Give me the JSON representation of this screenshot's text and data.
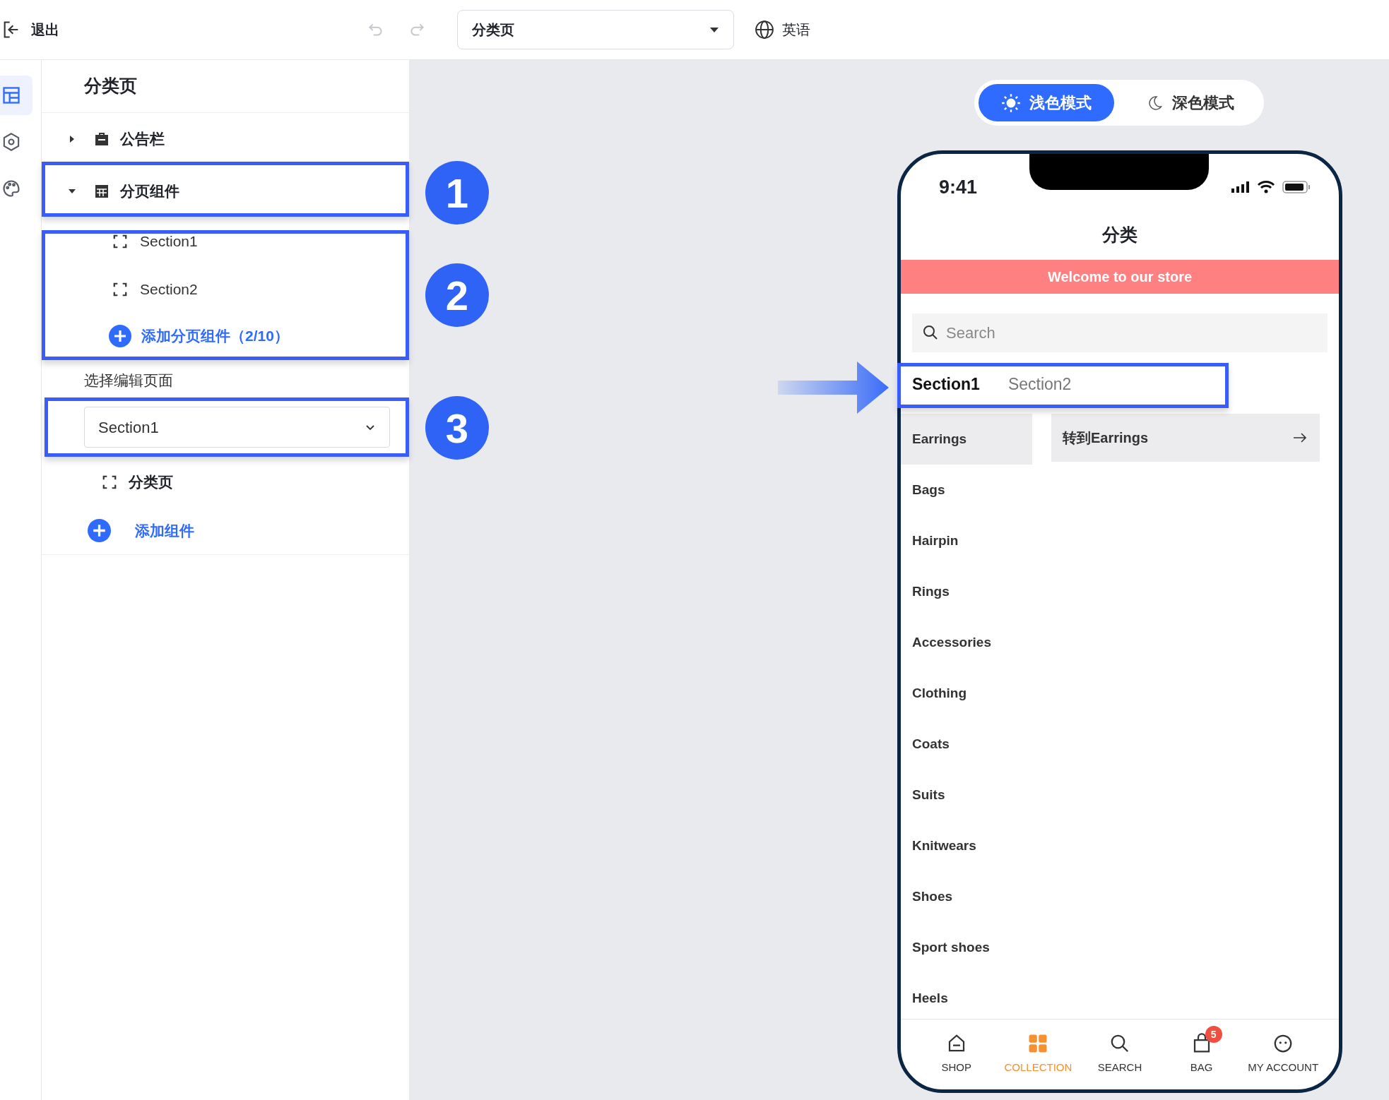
{
  "toolbar": {
    "exit_label": "退出",
    "page_select": "分类页",
    "language": "英语"
  },
  "rail": [
    {
      "kind": "layout",
      "selected": true
    },
    {
      "kind": "settings",
      "selected": false
    },
    {
      "kind": "palette",
      "selected": false
    }
  ],
  "panel": {
    "title": "分类页",
    "tree": [
      {
        "label": "公告栏",
        "kind": "notice",
        "expanded": false
      },
      {
        "label": "分页组件",
        "kind": "tabs",
        "expanded": true,
        "children": [
          {
            "label": "Section1"
          },
          {
            "label": "Section2"
          }
        ],
        "add_label": "添加分页组件（2/10）"
      }
    ],
    "edit_label": "选择编辑页面",
    "edit_select": "Section1",
    "page_item": "分类页",
    "add_component": "添加组件"
  },
  "callouts": [
    "1",
    "2",
    "3"
  ],
  "mode_toggle": [
    {
      "label": "浅色模式",
      "kind": "light",
      "selected": true
    },
    {
      "label": "深色模式",
      "kind": "dark",
      "selected": false
    }
  ],
  "phone": {
    "time": "9:41",
    "title": "分类",
    "banner": "Welcome to our store",
    "search": {
      "placeholder": "Search"
    },
    "tabs": [
      {
        "label": "Section1",
        "selected": true
      },
      {
        "label": "Section2",
        "selected": false
      }
    ],
    "categories": [
      {
        "label": "Earrings",
        "selected": true
      },
      {
        "label": "Bags",
        "selected": false
      },
      {
        "label": "Hairpin",
        "selected": false
      },
      {
        "label": "Rings",
        "selected": false
      },
      {
        "label": "Accessories",
        "selected": false
      },
      {
        "label": "Clothing",
        "selected": false
      },
      {
        "label": "Coats",
        "selected": false
      },
      {
        "label": "Suits",
        "selected": false
      },
      {
        "label": "Knitwears",
        "selected": false
      },
      {
        "label": "Shoes",
        "selected": false
      },
      {
        "label": "Sport shoes",
        "selected": false
      },
      {
        "label": "Heels",
        "selected": false
      }
    ],
    "jump_card": "转到Earrings",
    "nav": [
      {
        "label": "SHOP",
        "kind": "shop",
        "selected": false
      },
      {
        "label": "COLLECTION",
        "kind": "collection",
        "selected": true
      },
      {
        "label": "SEARCH",
        "kind": "search",
        "selected": false
      },
      {
        "label": "BAG",
        "kind": "bag",
        "selected": false,
        "badge": "5"
      },
      {
        "label": "MY ACCOUNT",
        "kind": "account",
        "selected": false
      }
    ]
  }
}
